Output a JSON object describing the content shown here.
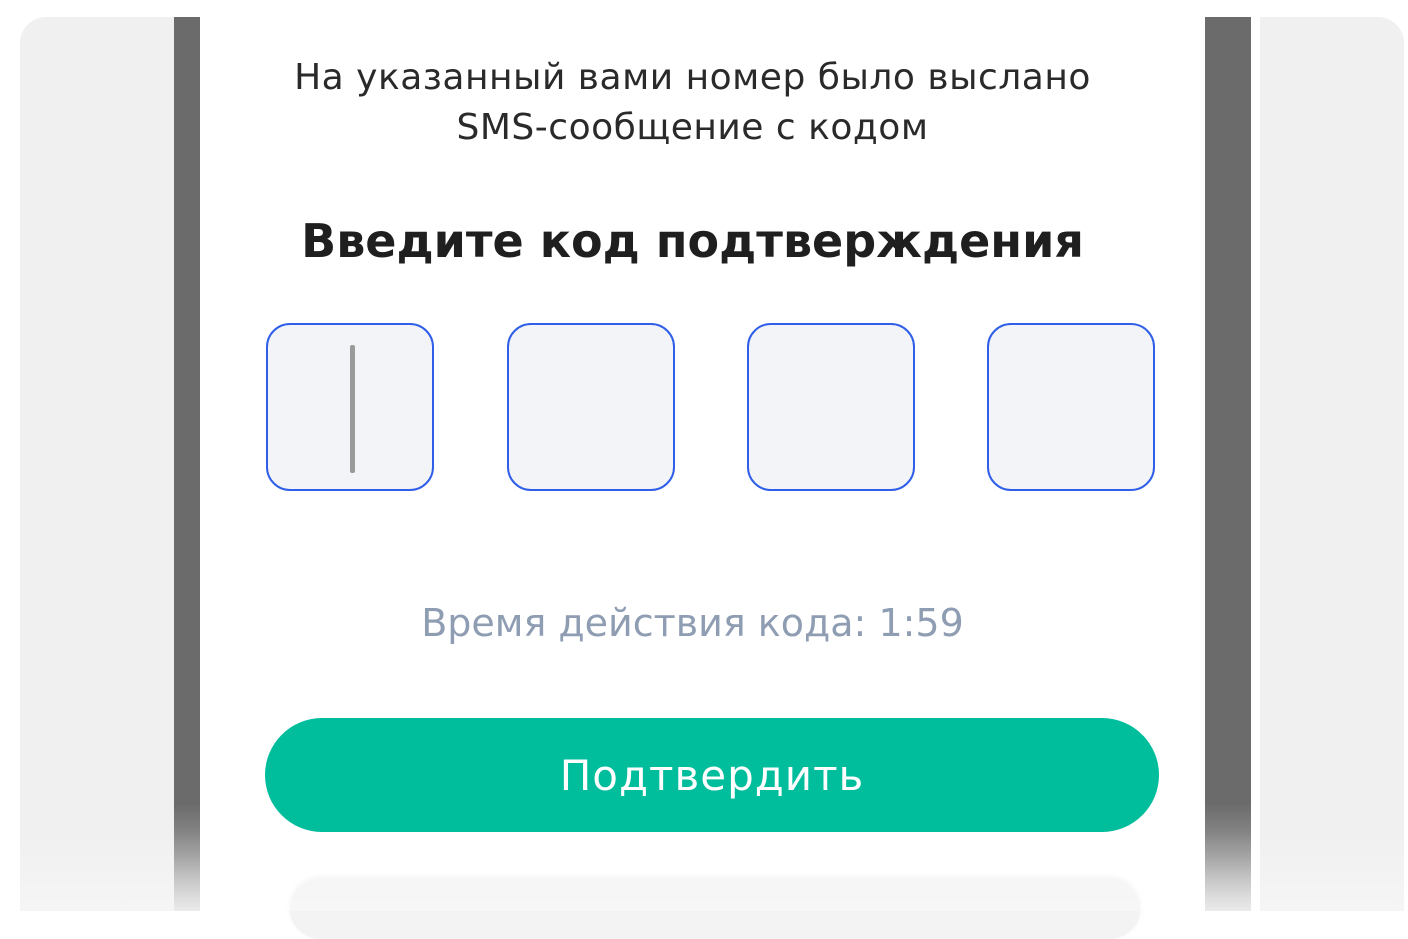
{
  "sms_info": {
    "line1": "На указанный вами номер  было выслано",
    "line2": "SMS-сообщение с кодом"
  },
  "heading": "Введите код подтверждения",
  "code_inputs": [
    {
      "value": "",
      "focused": true
    },
    {
      "value": "",
      "focused": false
    },
    {
      "value": "",
      "focused": false
    },
    {
      "value": "",
      "focused": false
    }
  ],
  "timer_text": "Время действия кода: 1:59",
  "confirm_button": {
    "label": "Подтвердить"
  },
  "colors": {
    "accent": "#00bd9c",
    "input_border": "#2f5ee8",
    "input_bg": "#f2f4f8",
    "timer_text": "#8f9db3",
    "frame": "#6b6b6b",
    "backdrop": "#f0f0f1"
  }
}
